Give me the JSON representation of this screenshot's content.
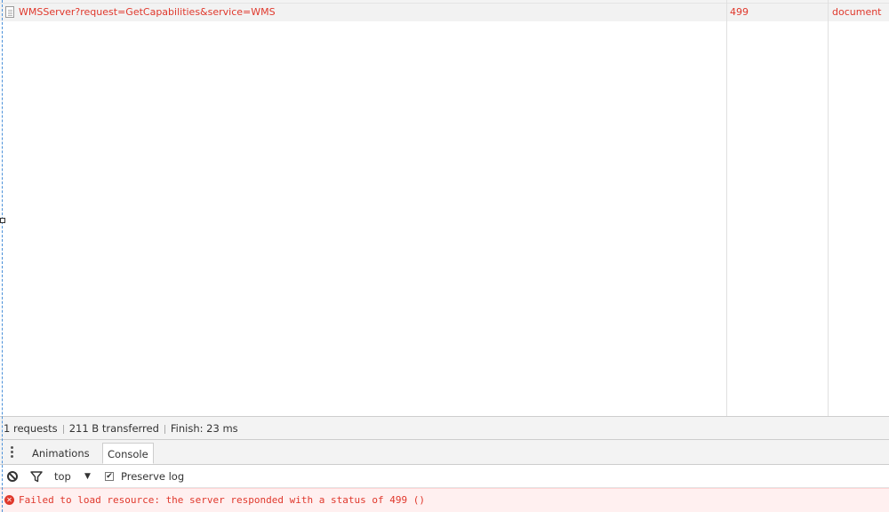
{
  "network": {
    "request": {
      "name": "WMSServer?request=GetCapabilities&service=WMS",
      "status": "499",
      "type": "document",
      "icon": "document-icon"
    }
  },
  "summary": {
    "requests": "1 requests",
    "transferred": "211 B transferred",
    "finish": "Finish: 23 ms"
  },
  "drawer": {
    "menu_icon": "kebab-menu-icon",
    "tabs": [
      {
        "label": "Animations",
        "active": false
      },
      {
        "label": "Console",
        "active": true
      }
    ]
  },
  "console_toolbar": {
    "clear_icon": "clear-console-icon",
    "filter_icon": "filter-icon",
    "context": "top",
    "context_arrow": "▼",
    "preserve_log_label": "Preserve log",
    "preserve_log_checked": true
  },
  "console_messages": [
    {
      "level": "error",
      "icon": "error-icon",
      "text": "Failed to load resource: the server responded with a status of 499 ()"
    }
  ],
  "colors": {
    "error_text": "#e0382c",
    "error_bg": "#fff0f0",
    "toolbar_bg": "#f3f3f3",
    "selected_row_bg": "#f2f2f2"
  }
}
